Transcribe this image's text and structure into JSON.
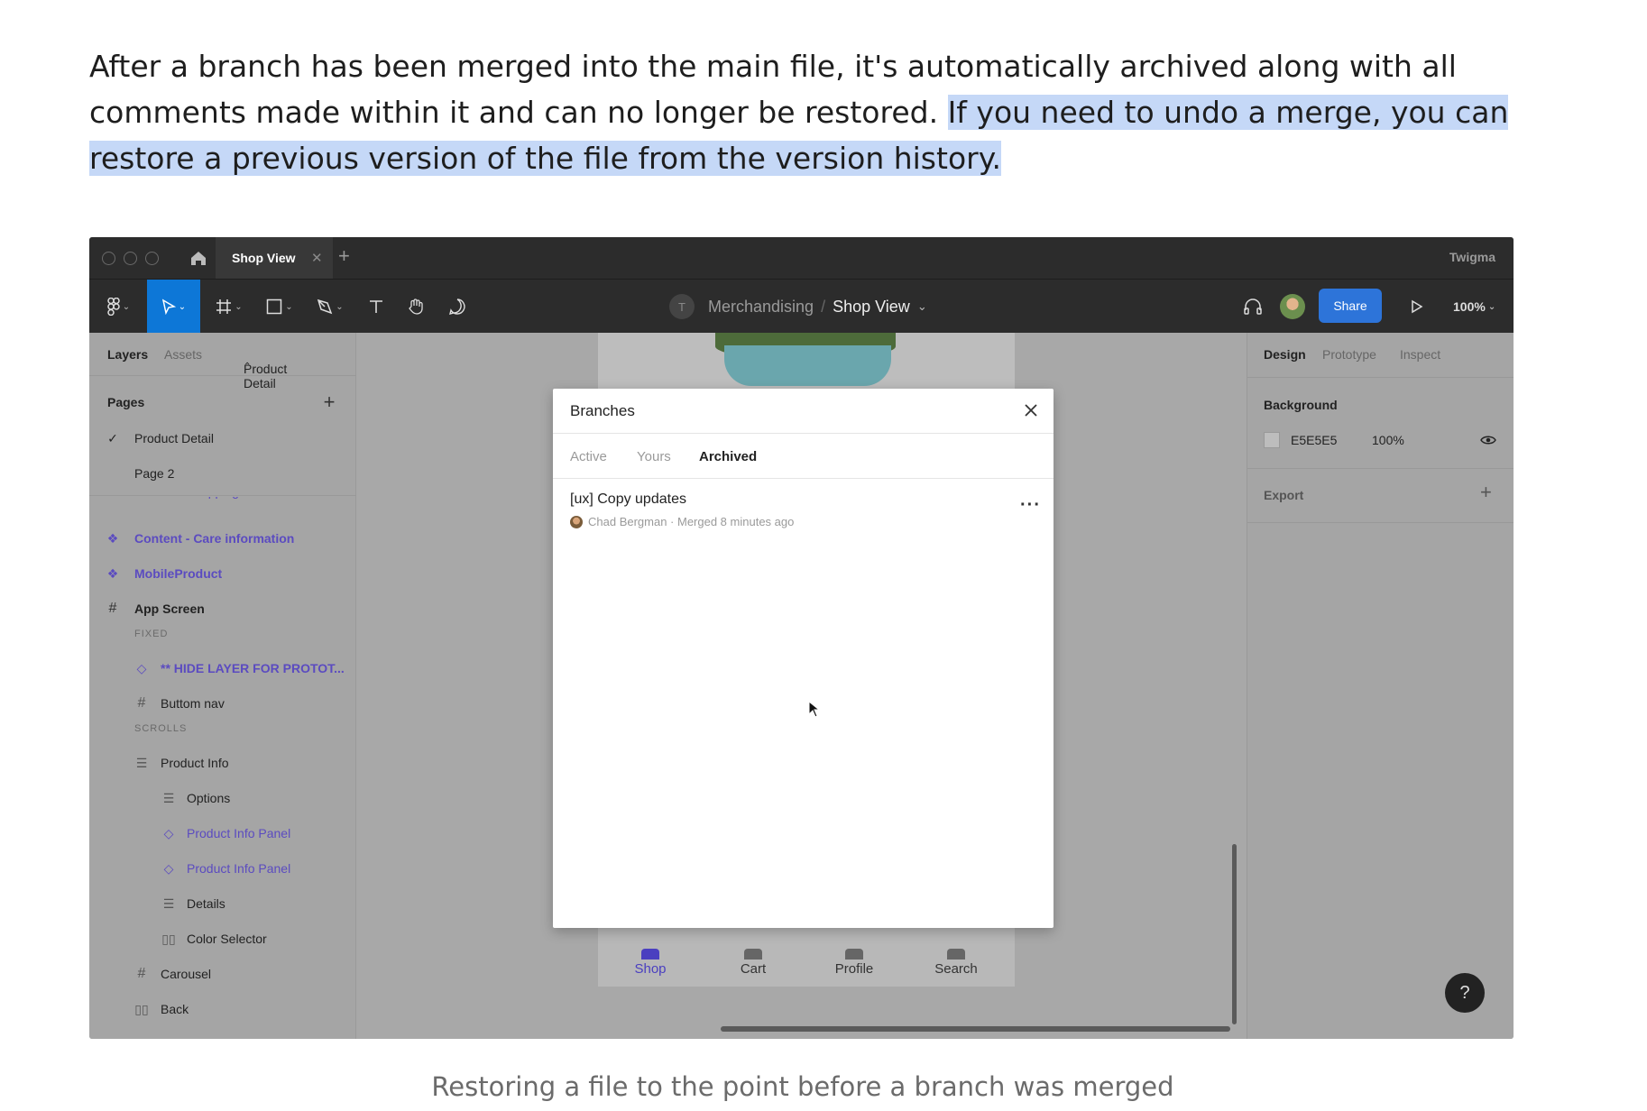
{
  "article": {
    "para_plain": "After a branch has been merged into the main file, it's automatically archived along with all comments made within it and can no longer be restored.",
    "para_highlight_1": "If you need to undo a merge, you can",
    "para_highlight_2": "restore a previous version of the file from the version history.",
    "caption": "Restoring a file to the point before a branch was merged"
  },
  "titlebar": {
    "tab_label": "Shop View",
    "brand": "Twigma"
  },
  "toolbar": {
    "avatar_letter": "T",
    "project": "Merchandising",
    "separator": "/",
    "file": "Shop View",
    "share_label": "Share",
    "zoom": "100%"
  },
  "left_panel": {
    "tabs": [
      "Layers",
      "Assets"
    ],
    "page_select": "Product Detail",
    "pages_heading": "Pages",
    "pages": [
      "Product Detail",
      "Page 2"
    ],
    "layers": [
      {
        "label": "Content - Shipping details",
        "icon": "component-icon"
      },
      {
        "label": "Content - Care information",
        "icon": "component-icon"
      },
      {
        "label": "MobileProduct",
        "icon": "component-icon"
      },
      {
        "label": "App Screen",
        "icon": "frame-icon"
      },
      {
        "label": "FIXED",
        "icon": ""
      },
      {
        "label": "** HIDE LAYER FOR PROTOT...",
        "icon": "instance-icon"
      },
      {
        "label": "Buttom nav",
        "icon": "frame-icon"
      },
      {
        "label": "SCROLLS",
        "icon": ""
      },
      {
        "label": "Product Info",
        "icon": "autolayout-icon"
      },
      {
        "label": "Options",
        "icon": "autolayout-icon"
      },
      {
        "label": "Product Info Panel",
        "icon": "instance-icon"
      },
      {
        "label": "Product Info Panel",
        "icon": "instance-icon"
      },
      {
        "label": "Details",
        "icon": "autolayout-icon"
      },
      {
        "label": "Color Selector",
        "icon": "columns-icon"
      },
      {
        "label": "Carousel",
        "icon": "frame-icon"
      },
      {
        "label": "Back",
        "icon": "columns-icon"
      }
    ]
  },
  "canvas": {
    "bottom_nav": [
      "Shop",
      "Cart",
      "Profile",
      "Search"
    ]
  },
  "right_panel": {
    "tabs": [
      "Design",
      "Prototype",
      "Inspect"
    ],
    "background_heading": "Background",
    "bg_hex": "E5E5E5",
    "bg_opacity": "100%",
    "export_heading": "Export"
  },
  "dialog": {
    "title": "Branches",
    "tabs": [
      "Active",
      "Yours",
      "Archived"
    ],
    "active_tab": "Archived",
    "branch": {
      "name": "[ux] Copy updates",
      "meta": "Chad Bergman · Merged 8 minutes ago"
    }
  },
  "help_label": "?",
  "colors": {
    "highlight": "#c5d8f7",
    "accent": "#0d77d7",
    "share": "#2d74d9",
    "component": "#5b4bc0"
  }
}
